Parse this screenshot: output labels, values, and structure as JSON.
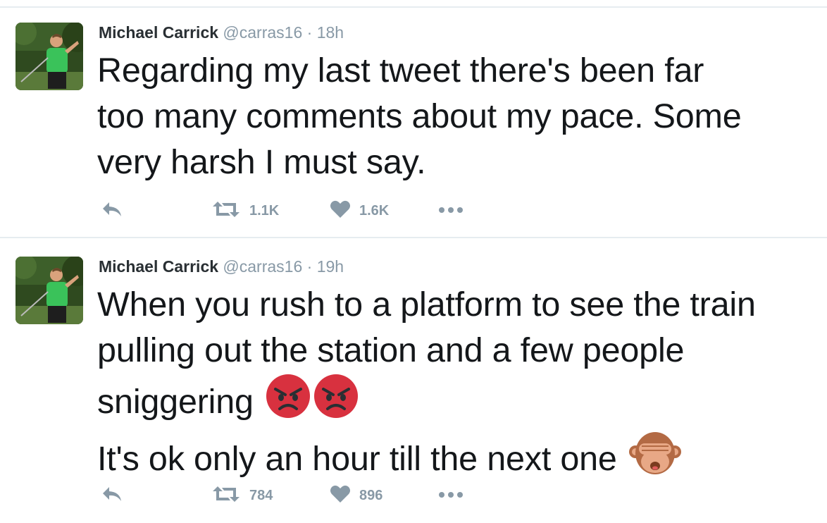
{
  "colors": {
    "meta_gray": "#8899a6",
    "text": "#14171a",
    "divider": "#e6ecf0",
    "angry_red": "#d8313f",
    "monkey_brown": "#b36a44"
  },
  "tweets": [
    {
      "display_name": "Michael Carrick",
      "handle": "@carras16",
      "separator": "·",
      "time": "18h",
      "text_lines": [
        "Regarding my last tweet there's been far",
        "too many comments about my pace. Some",
        "very harsh I must say."
      ],
      "emojis": [],
      "actions": {
        "reply_icon": "reply-icon",
        "retweet_icon": "retweet-icon",
        "retweet_count": "1.1K",
        "like_icon": "heart-icon",
        "like_count": "1.6K",
        "more_icon": "more-dots-icon"
      }
    },
    {
      "display_name": "Michael Carrick",
      "handle": "@carras16",
      "separator": "·",
      "time": "19h",
      "text_lines": [
        "When you rush to a platform to see the train",
        "pulling out the station and a few people",
        "sniggering",
        "It's ok only an hour till the next one"
      ],
      "emojis": [
        "angry-face-emoji",
        "angry-face-emoji",
        "see-no-evil-monkey-emoji"
      ],
      "actions": {
        "reply_icon": "reply-icon",
        "retweet_icon": "retweet-icon",
        "retweet_count": "784",
        "like_icon": "heart-icon",
        "like_count": "896",
        "more_icon": "more-dots-icon"
      }
    }
  ]
}
